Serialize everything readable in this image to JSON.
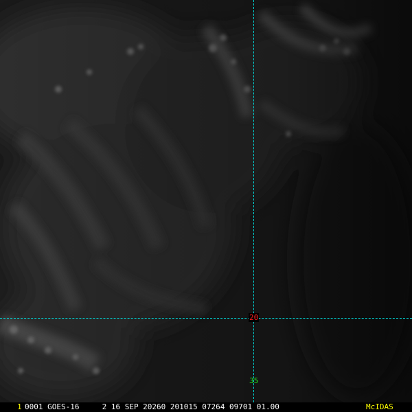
{
  "imagery": {
    "description_icon": "satellite-visible-cloud-icon"
  },
  "overlay": {
    "latitude_label": "20",
    "longitude_label": "35",
    "colors": {
      "gridline": "#00d6d6",
      "latitude_label": "#ff2020",
      "longitude_label": "#20e020"
    }
  },
  "status_bar": {
    "frame_number": "1",
    "info_text": "0001 GOES-16     2 16 SEP 20260 201015 07264 09701 01.00",
    "brand": "McIDAS",
    "colors": {
      "frame_number": "#ffff00",
      "info_text": "#ffffff",
      "brand": "#ffff00"
    }
  }
}
